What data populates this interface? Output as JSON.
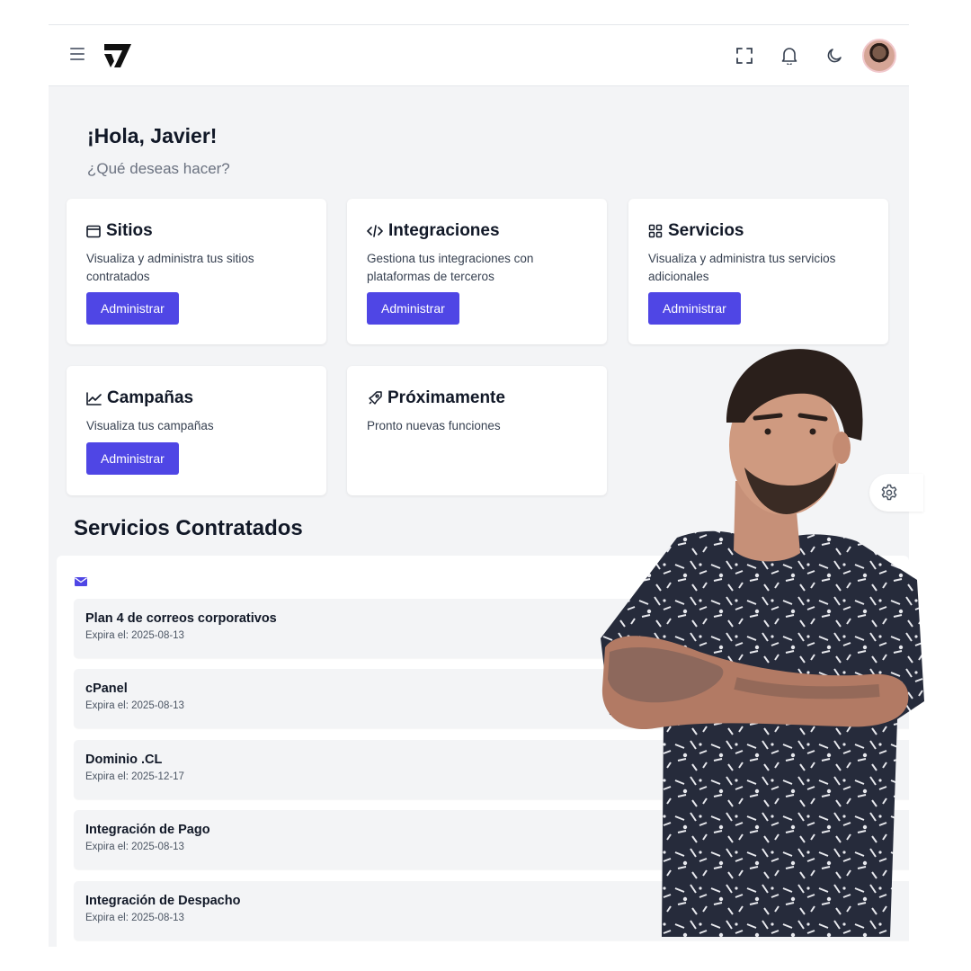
{
  "header": {
    "menu_icon": "hamburger-icon",
    "logo_icon": "brand-logo",
    "icons": [
      "fullscreen-icon",
      "bell-icon",
      "moon-icon"
    ],
    "avatar": "user-avatar"
  },
  "greeting": {
    "title": "¡Hola, Javier!",
    "subtitle": "¿Qué deseas hacer?"
  },
  "cards": [
    {
      "title": "Sitios",
      "icon": "browser-window-icon",
      "description": "Visualiza y administra tus sitios contratados",
      "button": "Administrar"
    },
    {
      "title": "Integraciones",
      "icon": "code-icon",
      "description": "Gestiona tus integraciones con plataformas de terceros",
      "button": "Administrar"
    },
    {
      "title": "Servicios",
      "icon": "grid-icon",
      "description": "Visualiza y administra tus servicios adicionales",
      "button": "Administrar"
    },
    {
      "title": "Campañas",
      "icon": "line-chart-icon",
      "description": "Visualiza tus campañas",
      "button": "Administrar"
    },
    {
      "title": "Próximamente",
      "icon": "rocket-icon",
      "description": "Pronto nuevas funciones"
    }
  ],
  "services": {
    "title": "Servicios Contratados",
    "icon": "mail-icon",
    "items": [
      {
        "name": "Plan 4 de correos corporativos",
        "expiry": "Expira el: 2025-08-13"
      },
      {
        "name": "cPanel",
        "expiry": "Expira el: 2025-08-13"
      },
      {
        "name": "Dominio .CL",
        "expiry": "Expira el: 2025-12-17"
      },
      {
        "name": "Integración de Pago",
        "expiry": "Expira el: 2025-08-13"
      },
      {
        "name": "Integración de Despacho",
        "expiry": "Expira el: 2025-08-13"
      }
    ]
  },
  "settings_icon": "gear-icon",
  "colors": {
    "accent": "#4f46e5",
    "background": "#f3f4f6",
    "card": "#ffffff",
    "text": "#111827"
  }
}
